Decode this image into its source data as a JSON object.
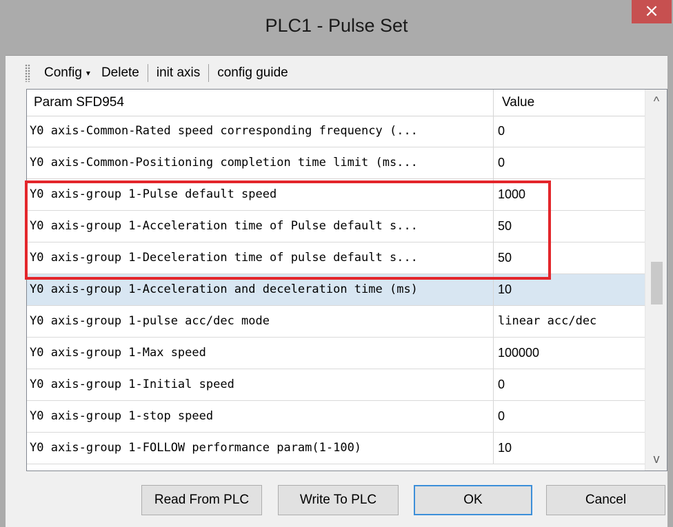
{
  "window": {
    "title": "PLC1 - Pulse  Set",
    "close_symbol": "×"
  },
  "toolbar": {
    "config_label": "Config",
    "config_caret": "▾",
    "delete_label": "Delete",
    "init_axis_label": "init axis",
    "config_guide_label": "config guide"
  },
  "grid": {
    "header_param": "Param SFD954",
    "header_value": "Value",
    "rows": [
      {
        "param": "Y0 axis-Common-Rated speed corresponding frequency (...",
        "value": "0"
      },
      {
        "param": "Y0 axis-Common-Positioning completion time limit (ms...",
        "value": "0"
      },
      {
        "param": "Y0 axis-group 1-Pulse default speed",
        "value": "1000"
      },
      {
        "param": "Y0 axis-group 1-Acceleration time of Pulse default s...",
        "value": "50"
      },
      {
        "param": "Y0 axis-group 1-Deceleration time of pulse default s...",
        "value": "50"
      },
      {
        "param": "Y0 axis-group 1-Acceleration and deceleration time (ms)",
        "value": "10"
      },
      {
        "param": "Y0 axis-group 1-pulse acc/dec mode",
        "value": "linear acc/dec"
      },
      {
        "param": "Y0 axis-group 1-Max speed",
        "value": "100000"
      },
      {
        "param": "Y0 axis-group 1-Initial speed",
        "value": "0"
      },
      {
        "param": "Y0 axis-group 1-stop speed",
        "value": "0"
      },
      {
        "param": "Y0 axis-group 1-FOLLOW performance param(1-100)",
        "value": "10"
      }
    ],
    "selected_row_index": 5,
    "scroll_up_symbol": "^",
    "scroll_down_symbol": "v"
  },
  "buttons": {
    "read_label": "Read From PLC",
    "write_label": "Write To PLC",
    "ok_label": "OK",
    "cancel_label": "Cancel"
  },
  "colors": {
    "highlight_box": "#e3262b",
    "selected_row": "#d8e6f2",
    "close_button": "#c75050"
  }
}
